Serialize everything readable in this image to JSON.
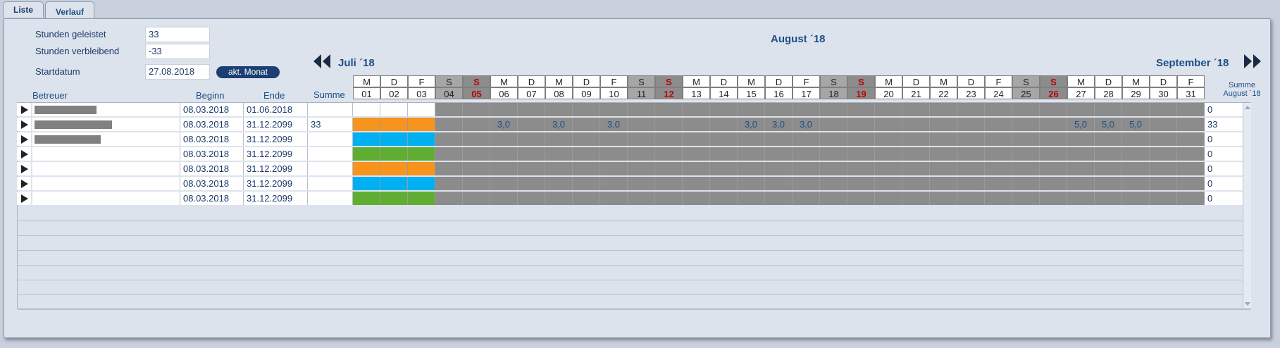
{
  "tabs": [
    {
      "label": "Liste",
      "active": false
    },
    {
      "label": "Verlauf",
      "active": true
    }
  ],
  "form": {
    "hours_done_label": "Stunden geleistet",
    "hours_done_value": "33",
    "hours_left_label": "Stunden verbleibend",
    "hours_left_value": "-33",
    "start_label": "Startdatum",
    "start_value": "27.08.2018",
    "current_month_button": "akt. Monat"
  },
  "months": {
    "current": "August ´18",
    "prev": "Juli ´18",
    "next": "September ´18"
  },
  "columns": {
    "betreuer": "Betreuer",
    "beginn": "Beginn",
    "ende": "Ende",
    "summe": "Summe",
    "summe_month_1": "Summe",
    "summe_month_2": "August ´18"
  },
  "days": [
    {
      "wd": "M",
      "d": "01",
      "t": "wd"
    },
    {
      "wd": "D",
      "d": "02",
      "t": "wd"
    },
    {
      "wd": "F",
      "d": "03",
      "t": "wd"
    },
    {
      "wd": "S",
      "d": "04",
      "t": "sa"
    },
    {
      "wd": "S",
      "d": "05",
      "t": "su"
    },
    {
      "wd": "M",
      "d": "06",
      "t": "wd"
    },
    {
      "wd": "D",
      "d": "07",
      "t": "wd"
    },
    {
      "wd": "M",
      "d": "08",
      "t": "wd"
    },
    {
      "wd": "D",
      "d": "09",
      "t": "wd"
    },
    {
      "wd": "F",
      "d": "10",
      "t": "wd"
    },
    {
      "wd": "S",
      "d": "11",
      "t": "sa"
    },
    {
      "wd": "S",
      "d": "12",
      "t": "su"
    },
    {
      "wd": "M",
      "d": "13",
      "t": "wd"
    },
    {
      "wd": "D",
      "d": "14",
      "t": "wd"
    },
    {
      "wd": "M",
      "d": "15",
      "t": "wd"
    },
    {
      "wd": "D",
      "d": "16",
      "t": "wd"
    },
    {
      "wd": "F",
      "d": "17",
      "t": "wd"
    },
    {
      "wd": "S",
      "d": "18",
      "t": "sa"
    },
    {
      "wd": "S",
      "d": "19",
      "t": "su"
    },
    {
      "wd": "M",
      "d": "20",
      "t": "wd"
    },
    {
      "wd": "D",
      "d": "21",
      "t": "wd"
    },
    {
      "wd": "M",
      "d": "22",
      "t": "wd"
    },
    {
      "wd": "D",
      "d": "23",
      "t": "wd"
    },
    {
      "wd": "F",
      "d": "24",
      "t": "wd"
    },
    {
      "wd": "S",
      "d": "25",
      "t": "sa"
    },
    {
      "wd": "S",
      "d": "26",
      "t": "su"
    },
    {
      "wd": "M",
      "d": "27",
      "t": "wd"
    },
    {
      "wd": "D",
      "d": "28",
      "t": "wd"
    },
    {
      "wd": "M",
      "d": "29",
      "t": "wd"
    },
    {
      "wd": "D",
      "d": "30",
      "t": "wd"
    },
    {
      "wd": "F",
      "d": "31",
      "t": "wd"
    }
  ],
  "rows": [
    {
      "name_masked": true,
      "mask_w": 88,
      "beginn": "08.03.2018",
      "ende": "01.06.2018",
      "summe": "",
      "color": "#ffffff",
      "values": {},
      "total": "0"
    },
    {
      "name_masked": true,
      "mask_w": 110,
      "beginn": "08.03.2018",
      "ende": "31.12.2099",
      "summe": "33",
      "color": "#f7941d",
      "values": {
        "6": "3,0",
        "8": "3,0",
        "10": "3,0",
        "15": "3,0",
        "16": "3,0",
        "17": "3,0",
        "27": "5,0",
        "28": "5,0",
        "29": "5,0"
      },
      "total": "33"
    },
    {
      "name_masked": true,
      "mask_w": 94,
      "beginn": "08.03.2018",
      "ende": "31.12.2099",
      "summe": "",
      "color": "#00b0f0",
      "values": {},
      "total": "0"
    },
    {
      "name_masked": false,
      "mask_w": 0,
      "beginn": "08.03.2018",
      "ende": "31.12.2099",
      "summe": "",
      "color": "#5fae32",
      "values": {},
      "total": "0"
    },
    {
      "name_masked": false,
      "mask_w": 0,
      "beginn": "08.03.2018",
      "ende": "31.12.2099",
      "summe": "",
      "color": "#f7941d",
      "values": {},
      "total": "0"
    },
    {
      "name_masked": false,
      "mask_w": 0,
      "beginn": "08.03.2018",
      "ende": "31.12.2099",
      "summe": "",
      "color": "#00b0f0",
      "values": {},
      "total": "0"
    },
    {
      "name_masked": false,
      "mask_w": 0,
      "beginn": "08.03.2018",
      "ende": "31.12.2099",
      "summe": "",
      "color": "#5fae32",
      "values": {},
      "total": "0"
    }
  ],
  "colors": {
    "inactive": "#8c8c8c",
    "weekend_header": "#a6a6a6"
  }
}
